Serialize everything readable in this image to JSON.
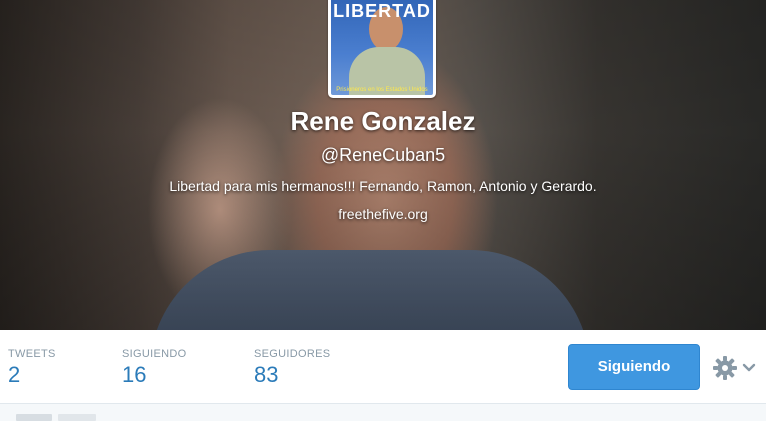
{
  "profile": {
    "name": "Rene Gonzalez",
    "screen_name": "@ReneCuban5",
    "bio": "Libertad para mis hermanos!!! Fernando, Ramon, Antonio y Gerardo.",
    "url": "freethefive.org",
    "avatar_banner": "LIBERTAD",
    "avatar_caption": "Prisioneros en los Estados Unidos"
  },
  "stats": {
    "tweets_label": "TWEETS",
    "tweets_count": "2",
    "following_label": "SIGUIENDO",
    "following_count": "16",
    "followers_label": "SEGUIDORES",
    "followers_count": "83"
  },
  "actions": {
    "follow_button_label": "Siguiendo",
    "settings_icon": "gear-icon",
    "dropdown_icon": "chevron-down-icon"
  },
  "colors": {
    "accent": "#3f97e0",
    "stat_number": "#2b7bb9",
    "stat_label": "#8899a6"
  }
}
